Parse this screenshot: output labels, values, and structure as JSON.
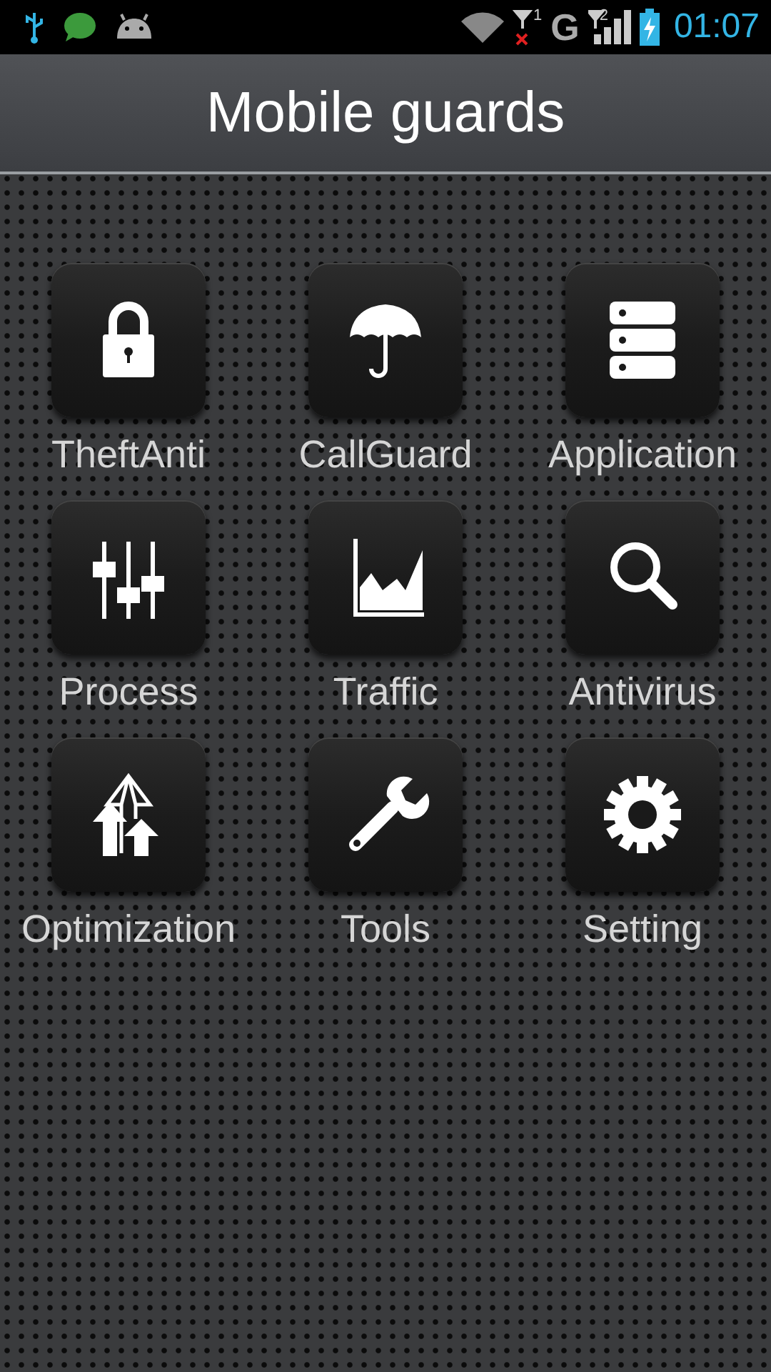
{
  "status_bar": {
    "sim1_label": "1",
    "network": "G",
    "sim2_label": "2",
    "time": "01:07"
  },
  "header": {
    "title": "Mobile guards"
  },
  "tiles": [
    {
      "label": "TheftAnti",
      "kind": "lock"
    },
    {
      "label": "CallGuard",
      "kind": "umbrella"
    },
    {
      "label": "Application",
      "kind": "list"
    },
    {
      "label": "Process",
      "kind": "sliders"
    },
    {
      "label": "Traffic",
      "kind": "chart"
    },
    {
      "label": "Antivirus",
      "kind": "search"
    },
    {
      "label": "Optimization",
      "kind": "arrows"
    },
    {
      "label": "Tools",
      "kind": "wrench"
    },
    {
      "label": "Setting",
      "kind": "gear"
    }
  ]
}
